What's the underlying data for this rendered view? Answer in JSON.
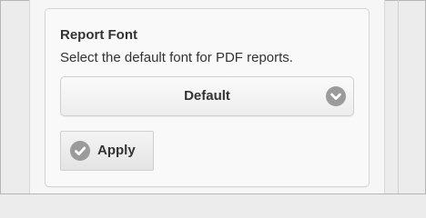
{
  "settings": {
    "section_title": "Report Font",
    "section_description": "Select the default font for PDF reports.",
    "font_select": {
      "selected_value": "Default",
      "icon": "chevron-down-icon"
    },
    "apply_button": {
      "label": "Apply",
      "icon": "check-icon"
    }
  },
  "colors": {
    "icon_circle": "#9b9b9b",
    "text": "#333333",
    "card_border": "#d4d4d4"
  }
}
